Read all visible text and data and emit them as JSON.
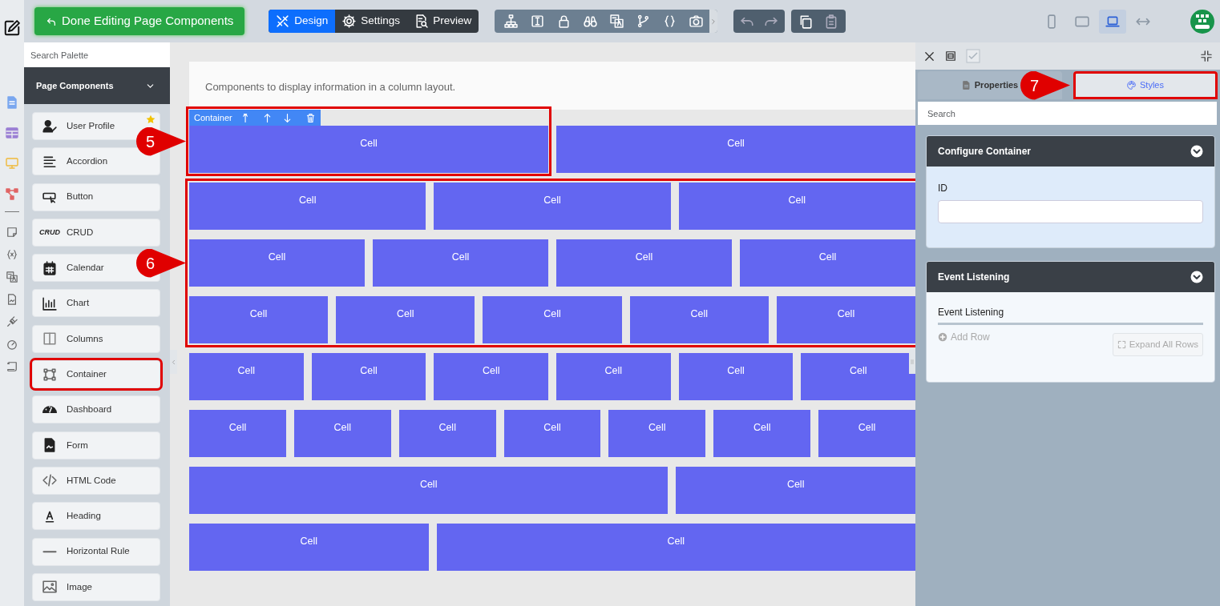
{
  "toolbar": {
    "done_button": "Done Editing Page Components",
    "modes": [
      {
        "label": "Design",
        "kind": "design",
        "selected": true
      },
      {
        "label": "Settings",
        "kind": "settings",
        "selected": false
      },
      {
        "label": "Preview",
        "kind": "preview",
        "selected": false
      }
    ],
    "devices": [
      {
        "kind": "phone",
        "selected": false
      },
      {
        "kind": "tablet",
        "selected": false
      },
      {
        "kind": "laptop",
        "selected": true
      },
      {
        "kind": "fluid",
        "selected": false
      }
    ]
  },
  "palette": {
    "search_placeholder": "Search Palette",
    "title": "Page Components",
    "items": [
      {
        "label": "User Profile",
        "kind": "user",
        "starred": true,
        "highlighted": false
      },
      {
        "label": "Accordion",
        "kind": "accordion",
        "starred": false,
        "highlighted": false
      },
      {
        "label": "Button",
        "kind": "button",
        "starred": false,
        "highlighted": false
      },
      {
        "label": "CRUD",
        "kind": "crud",
        "icon_text": "CRUD",
        "starred": false,
        "highlighted": false
      },
      {
        "label": "Calendar",
        "kind": "calendar",
        "starred": false,
        "highlighted": false
      },
      {
        "label": "Chart",
        "kind": "chart",
        "starred": false,
        "highlighted": false
      },
      {
        "label": "Columns",
        "kind": "columns",
        "starred": false,
        "highlighted": false
      },
      {
        "label": "Container",
        "kind": "container",
        "starred": false,
        "highlighted": true
      },
      {
        "label": "Dashboard",
        "kind": "dashboard",
        "starred": false,
        "highlighted": false
      },
      {
        "label": "Form",
        "kind": "form",
        "starred": false,
        "highlighted": false
      },
      {
        "label": "HTML Code",
        "kind": "html",
        "starred": false,
        "highlighted": false
      },
      {
        "label": "Heading",
        "kind": "heading",
        "starred": false,
        "highlighted": false
      },
      {
        "label": "Horizontal Rule",
        "kind": "rule",
        "starred": false,
        "highlighted": false
      },
      {
        "label": "Image",
        "kind": "image",
        "starred": false,
        "highlighted": false
      }
    ]
  },
  "canvas": {
    "description": "Components to display information in a column layout.",
    "container_toolbar": "Container",
    "blocks": [
      {
        "rows": [
          {
            "cells": [
              {
                "label": "Cell",
                "kind": "normal",
                "selected": true,
                "callout": "5"
              },
              {
                "label": "Cell",
                "kind": "normal",
                "selected": false
              }
            ]
          }
        ]
      },
      {
        "callout": "6",
        "rows": [
          {
            "cells": [
              {
                "label": "Cell",
                "kind": "normal",
                "selected": false
              },
              {
                "label": "Cell",
                "kind": "normal",
                "selected": false
              },
              {
                "label": "Cell",
                "kind": "normal",
                "selected": false
              }
            ]
          },
          {
            "cells": [
              {
                "label": "Cell",
                "kind": "normal",
                "selected": false
              },
              {
                "label": "Cell",
                "kind": "normal",
                "selected": false
              },
              {
                "label": "Cell",
                "kind": "normal",
                "selected": false
              },
              {
                "label": "Cell",
                "kind": "normal",
                "selected": false
              }
            ]
          },
          {
            "cells": [
              {
                "label": "Cell",
                "kind": "normal",
                "selected": false
              },
              {
                "label": "Cell",
                "kind": "normal",
                "selected": false
              },
              {
                "label": "Cell",
                "kind": "normal",
                "selected": false
              },
              {
                "label": "Cell",
                "kind": "normal",
                "selected": false
              },
              {
                "label": "Cell",
                "kind": "normal",
                "selected": false
              }
            ]
          }
        ]
      },
      {
        "rows": [
          {
            "cells": [
              {
                "label": "Cell",
                "kind": "normal",
                "selected": false
              },
              {
                "label": "Cell",
                "kind": "normal",
                "selected": false
              },
              {
                "label": "Cell",
                "kind": "normal",
                "selected": false
              },
              {
                "label": "Cell",
                "kind": "normal",
                "selected": false
              },
              {
                "label": "Cell",
                "kind": "normal",
                "selected": false
              },
              {
                "label": "Cell",
                "kind": "normal",
                "selected": false
              }
            ]
          },
          {
            "cells": [
              {
                "label": "Cell",
                "kind": "normal",
                "selected": false
              },
              {
                "label": "Cell",
                "kind": "normal",
                "selected": false
              },
              {
                "label": "Cell",
                "kind": "normal",
                "selected": false
              },
              {
                "label": "Cell",
                "kind": "normal",
                "selected": false
              },
              {
                "label": "Cell",
                "kind": "normal",
                "selected": false
              },
              {
                "label": "Cell",
                "kind": "normal",
                "selected": false
              },
              {
                "label": "Cell",
                "kind": "normal",
                "selected": false
              }
            ]
          },
          {
            "cells": [
              {
                "label": "Cell",
                "kind": "wide",
                "selected": false
              },
              {
                "label": "Cell",
                "kind": "normal",
                "selected": false
              }
            ]
          },
          {
            "cells": [
              {
                "label": "Cell",
                "kind": "normal",
                "selected": false
              },
              {
                "label": "Cell",
                "kind": "wide",
                "selected": false
              }
            ]
          }
        ]
      }
    ]
  },
  "inspector": {
    "tabs": [
      {
        "label": "Properties",
        "kind": "properties",
        "selected": true
      },
      {
        "label": "Styles",
        "kind": "styles",
        "selected": false,
        "callout": "7"
      }
    ],
    "search_placeholder": "Search",
    "sections": [
      {
        "kind": "form",
        "title": "Configure Container",
        "field_label": "ID"
      },
      {
        "kind": "events",
        "title": "Event Listening",
        "table_label": "Event Listening",
        "add_row": {
          "label": "Add Row",
          "disabled": true
        },
        "expand_rows": {
          "label": "Expand All Rows",
          "disabled": true
        }
      }
    ]
  }
}
